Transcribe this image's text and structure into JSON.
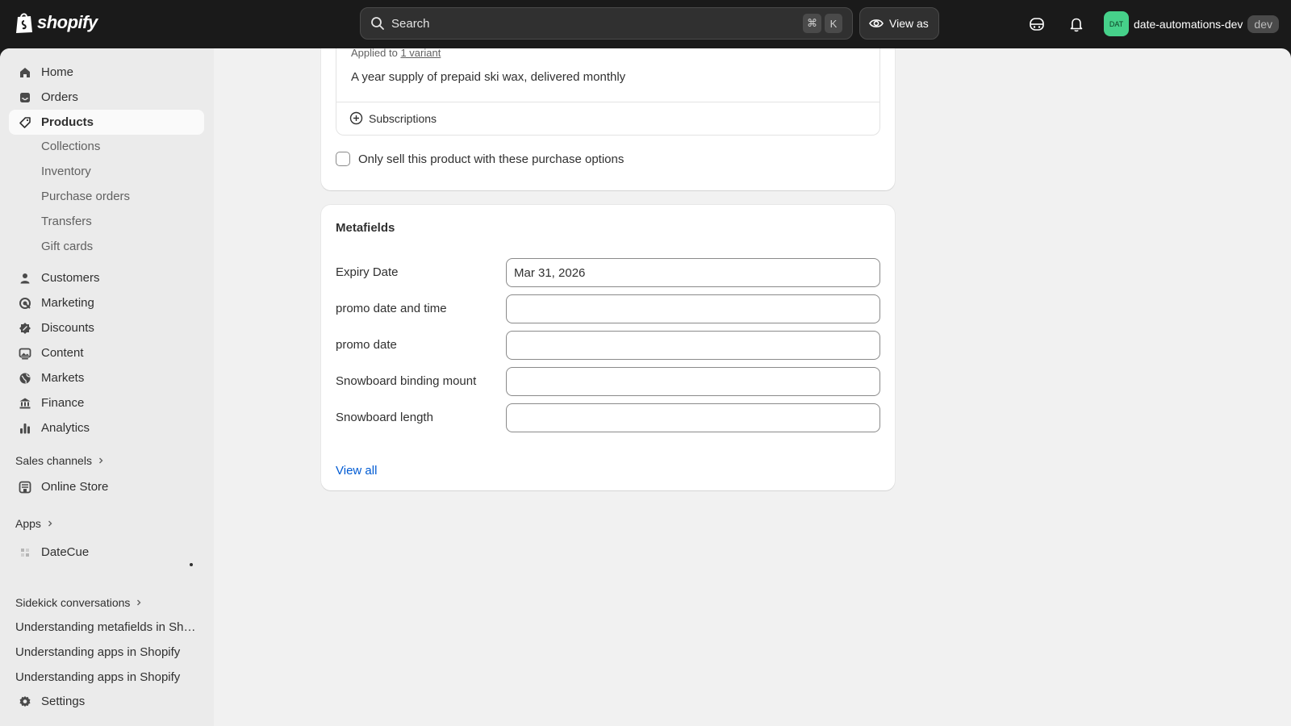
{
  "topbar": {
    "logo_text": "shopify",
    "search_placeholder": "Search",
    "shortcut_keys": [
      "⌘",
      "K"
    ],
    "view_as_label": "View as",
    "store_initials": "DAT",
    "store_name": "date-automations-dev",
    "store_badge": "dev"
  },
  "sidebar": {
    "main_items": [
      {
        "label": "Home",
        "icon": "home-icon"
      },
      {
        "label": "Orders",
        "icon": "inbox-icon"
      },
      {
        "label": "Products",
        "icon": "tag-icon",
        "active": true
      }
    ],
    "product_subitems": [
      "Collections",
      "Inventory",
      "Purchase orders",
      "Transfers",
      "Gift cards"
    ],
    "more_items": [
      {
        "label": "Customers",
        "icon": "person-icon"
      },
      {
        "label": "Marketing",
        "icon": "target-icon"
      },
      {
        "label": "Discounts",
        "icon": "discount-icon"
      },
      {
        "label": "Content",
        "icon": "image-icon"
      },
      {
        "label": "Markets",
        "icon": "globe-icon"
      },
      {
        "label": "Finance",
        "icon": "bank-icon"
      },
      {
        "label": "Analytics",
        "icon": "bar-chart-icon"
      }
    ],
    "sales_channels_label": "Sales channels",
    "online_store_label": "Online Store",
    "apps_label": "Apps",
    "datecue_label": "DateCue",
    "sidekick_label": "Sidekick conversations",
    "conversations": [
      "Understanding metafields in Shopify",
      "Understanding apps in Shopify",
      "Understanding apps in Shopify"
    ],
    "settings_label": "Settings"
  },
  "purchase_options": {
    "applied_to_prefix": "Applied to",
    "applied_to_link": "1 variant",
    "description": "A year supply of prepaid ski wax, delivered monthly",
    "subscriptions_label": "Subscriptions",
    "only_sell_label": "Only sell this product with these purchase options",
    "only_sell_checked": false
  },
  "metafields": {
    "title": "Metafields",
    "fields": [
      {
        "label": "Expiry Date",
        "value": "Mar 31, 2026"
      },
      {
        "label": "promo date and time",
        "value": ""
      },
      {
        "label": "promo date",
        "value": ""
      },
      {
        "label": "Snowboard binding mount",
        "value": ""
      },
      {
        "label": "Snowboard length",
        "value": ""
      }
    ],
    "view_all_label": "View all"
  },
  "colors": {
    "topbar_bg": "#1a1a1a",
    "page_bg": "#f1f1f1",
    "sidebar_bg": "#ebebeb",
    "link": "#005bd3",
    "avatar_bg": "#46d18a"
  }
}
